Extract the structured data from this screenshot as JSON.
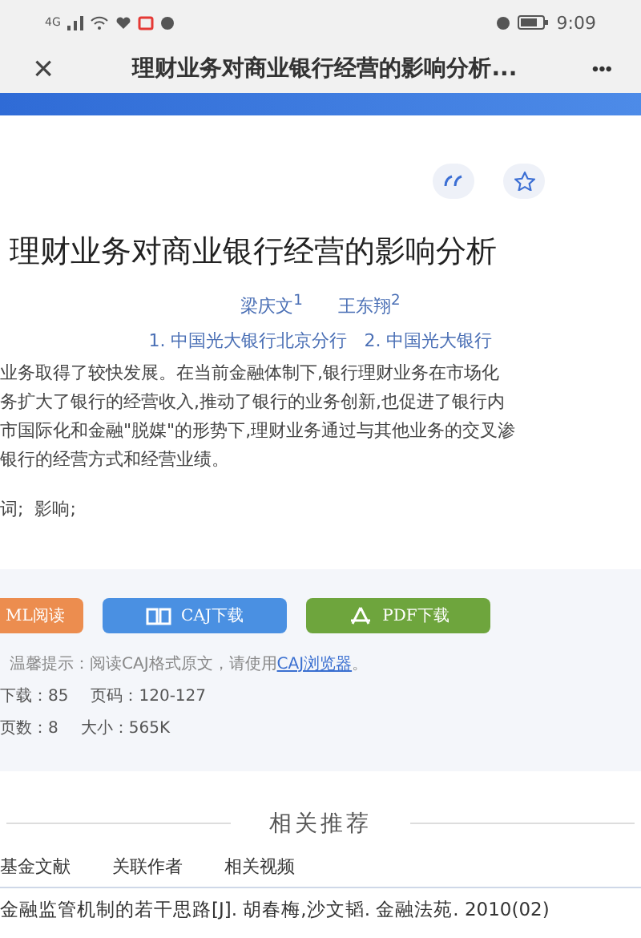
{
  "status_bar": {
    "network": "4G",
    "time": "9:09"
  },
  "nav": {
    "close": "×",
    "title": "理财业务对商业银行经营的影响分析...",
    "more": "•••"
  },
  "article": {
    "title": "理财业务对商业银行经营的影响分析",
    "authors": [
      "梁庆文$^{1}$",
      "王东翔$^{2}$"
    ],
    "affiliations": "1. 中国光大银行北京分行   2. 中国光大银行",
    "abstract_lines": [
      "业务取得了较快发展。在当前金融体制下,银行理财业务在市场化",
      "务扩大了银行的经营收入,推动了银行的业务创新,也促进了银行内",
      "市国际化和金融\"脱媒\"的形势下,理财业务通过与其他业务的交叉渗",
      "银行的经营方式和经营业绩。"
    ],
    "keywords": "词;  影响;"
  },
  "downloads": {
    "buttons": [
      {
        "kind": "html",
        "label": "ML阅读"
      },
      {
        "kind": "caj",
        "label": "CAJ下载"
      },
      {
        "kind": "pdf",
        "label": "PDF下载"
      }
    ],
    "tip": "温馨提示：阅读CAJ格式原文，请使用",
    "tip_link": "CAJ浏览器",
    "tip_end": "。",
    "stats": [
      [
        "下载：85",
        "页码：120-127"
      ],
      [
        "页数：8",
        "大小：565K"
      ]
    ]
  },
  "related": {
    "heading": "相关推荐",
    "tabs": [
      {
        "label": "基金文献",
        "selected": false
      },
      {
        "label": "关联作者",
        "selected": false
      },
      {
        "label": "相关视频",
        "selected": false
      }
    ],
    "items": [
      "金融监管机制的若干思路[J]. 胡春梅,沙文韬. 金融法苑. 2010(02)"
    ]
  }
}
